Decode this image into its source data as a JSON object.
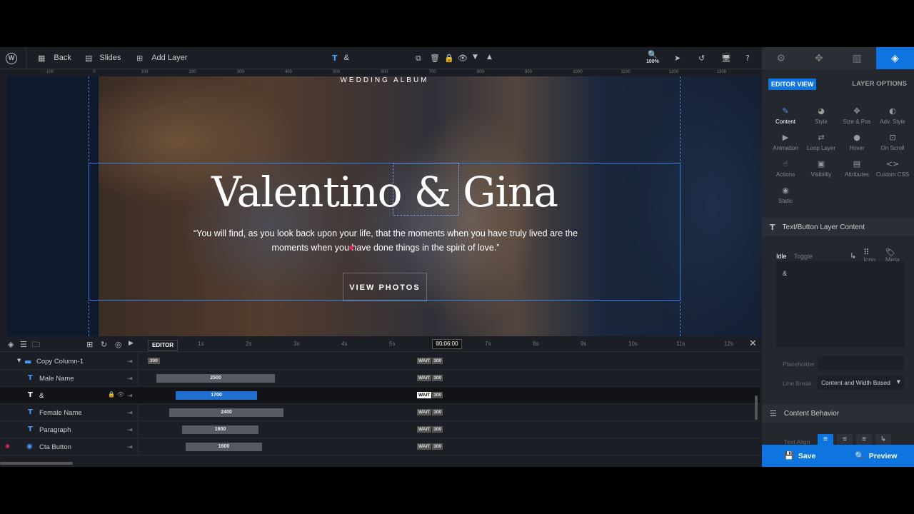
{
  "toolbar": {
    "back": "Back",
    "slides": "Slides",
    "add_layer": "Add Layer",
    "current_layer": "&",
    "zoom": "100%"
  },
  "ruler": [
    "-100",
    "0",
    "100",
    "200",
    "300",
    "400",
    "500",
    "600",
    "700",
    "800",
    "900",
    "1000",
    "1100",
    "1200",
    "1300"
  ],
  "slide": {
    "album": "WEDDING ALBUM",
    "names": "Valentino & Gina",
    "quote": "“You will find, as you look back upon your life, that the moments when you have truly lived are the moments when you have done things in the spirit of love.”",
    "cta": "VIEW PHOTOS"
  },
  "panel": {
    "editor_view": "EDITOR VIEW",
    "layer_options": "LAYER OPTIONS",
    "grid": [
      {
        "label": "Content",
        "icon": "pencil-icon"
      },
      {
        "label": "Style",
        "icon": "palette-icon"
      },
      {
        "label": "Size & Pos",
        "icon": "move-icon"
      },
      {
        "label": "Adv. Style",
        "icon": "drop-icon"
      },
      {
        "label": "Animation",
        "icon": "play-icon"
      },
      {
        "label": "Loop Layer",
        "icon": "loop-icon"
      },
      {
        "label": "Hover",
        "icon": "mouse-icon"
      },
      {
        "label": "On Scroll",
        "icon": "scroll-icon"
      },
      {
        "label": "Actions",
        "icon": "hand-icon"
      },
      {
        "label": "Visibility",
        "icon": "screen-icon"
      },
      {
        "label": "Attributes",
        "icon": "file-icon"
      },
      {
        "label": "Custom CSS",
        "icon": "code-icon"
      },
      {
        "label": "Static",
        "icon": "circle-icon"
      }
    ],
    "section_text": "Text/Button Layer Content",
    "idle": "Idle",
    "toggle": "Toggle",
    "icon": "Icon",
    "meta": "Meta",
    "text_value": "&",
    "placeholder_label": "Placeholder",
    "linebreak_label": "Line Break",
    "linebreak_value": "Content and Width Based",
    "section_behavior": "Content Behavior",
    "text_align": "Text Align",
    "save": "Save",
    "preview": "Preview"
  },
  "timeline": {
    "editor": "EDITOR",
    "time": "00:06:00",
    "ticks": [
      "1s",
      "2s",
      "3s",
      "4s",
      "5s",
      "6s",
      "7s",
      "8s",
      "9s",
      "10s",
      "11s",
      "12s"
    ],
    "group": {
      "name": "Copy Column-1",
      "value": "300"
    },
    "wait": "WAIT",
    "layers": [
      {
        "name": "Male Name",
        "duration": "2500",
        "wait_value": "300"
      },
      {
        "name": "&",
        "duration": "1700",
        "wait_value": "300"
      },
      {
        "name": "Female Name",
        "duration": "2400",
        "wait_value": "300"
      },
      {
        "name": "Paragraph",
        "duration": "1600",
        "wait_value": "300"
      },
      {
        "name": "Cta Button",
        "duration": "1600",
        "wait_value": "300"
      }
    ]
  },
  "colors": {
    "accent": "#0e74e0",
    "selection": "#3b82e6"
  }
}
